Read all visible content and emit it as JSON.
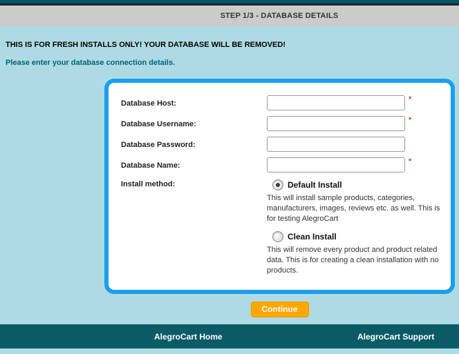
{
  "header": {
    "title": "STEP 1/3 - DATABASE DETAILS"
  },
  "intro": {
    "warning": "THIS IS FOR FRESH INSTALLS ONLY! YOUR DATABASE WILL BE REMOVED!",
    "instruction": "Please enter your database connection details."
  },
  "form": {
    "required_marker": "*",
    "fields": [
      {
        "label": "Database Host:",
        "value": "",
        "required": true
      },
      {
        "label": "Database Username:",
        "value": "",
        "required": true
      },
      {
        "label": "Database Password:",
        "value": "",
        "required": false
      },
      {
        "label": "Database Name:",
        "value": "",
        "required": true
      }
    ],
    "install_method": {
      "label": "Install method:",
      "options": [
        {
          "label": "Default Install",
          "selected": true,
          "description": "This will install sample products, categories, manufacturers, images, reviews etc. as well. This is for testing AlegroCart"
        },
        {
          "label": "Clean Install",
          "selected": false,
          "description": "This will remove every product and product related data. This is for creating a clean installation with no products."
        }
      ]
    }
  },
  "actions": {
    "continue_label": "Continue"
  },
  "footer": {
    "links": [
      {
        "label": "AlegroCart Home"
      },
      {
        "label": "AlegroCart Support"
      }
    ]
  },
  "colors": {
    "accent_blue": "#1B9EF0",
    "button_orange": "#FFA600",
    "teal_dark": "#0B5B66",
    "teal_top_bar": "#00566B",
    "header_gray": "#CBCBCB",
    "page_bg": "#AEDBE3",
    "required_red": "#E63A2E",
    "instruction_teal": "#00627A"
  }
}
